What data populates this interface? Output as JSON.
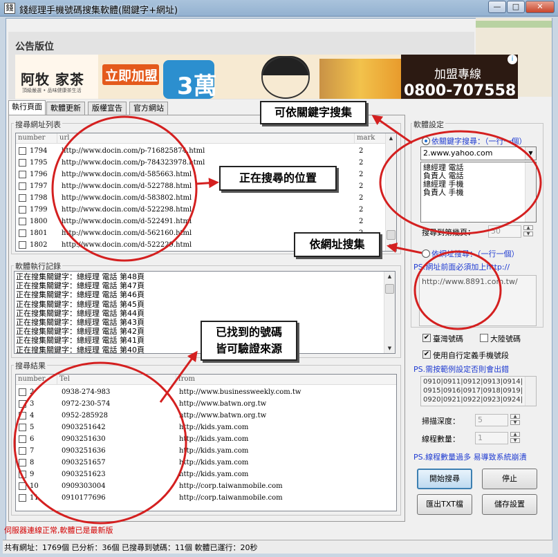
{
  "window": {
    "title": "錢經理手機號碼搜集軟體(關鍵字+網址)",
    "minimize": "—",
    "maximize": "□",
    "close": "✕"
  },
  "announcement": {
    "title": "公告版位",
    "ad": {
      "brand": "阿牧 家茶",
      "brand_sub": "頂級嚴選 • 品味健康茶生活",
      "join": "立即加盟",
      "big_number": "3萬",
      "hotline_label": "加盟專線",
      "phone": "0800-707558"
    }
  },
  "tabs": [
    {
      "label": "執行頁面",
      "active": true
    },
    {
      "label": "軟體更新",
      "active": false
    },
    {
      "label": "版權宣告",
      "active": false
    },
    {
      "label": "官方網站",
      "active": false
    }
  ],
  "url_list": {
    "title": "搜尋網址列表",
    "columns": [
      "number",
      "url",
      "mark"
    ],
    "rows": [
      {
        "number": "1794",
        "url": "http://www.docin.com/p-716825874.html",
        "mark": "2"
      },
      {
        "number": "1795",
        "url": "http://www.docin.com/p-784323978.html",
        "mark": "2"
      },
      {
        "number": "1796",
        "url": "http://www.docin.com/d-585663.html",
        "mark": "2"
      },
      {
        "number": "1797",
        "url": "http://www.docin.com/d-522788.html",
        "mark": "2"
      },
      {
        "number": "1798",
        "url": "http://www.docin.com/d-583802.html",
        "mark": "2"
      },
      {
        "number": "1799",
        "url": "http://www.docin.com/d-522298.html",
        "mark": "2"
      },
      {
        "number": "1800",
        "url": "http://www.docin.com/d-522491.html",
        "mark": "2"
      },
      {
        "number": "1801",
        "url": "http://www.docin.com/d-562160.html",
        "mark": "2"
      },
      {
        "number": "1802",
        "url": "http://www.docin.com/d-522229.html",
        "mark": "2"
      }
    ]
  },
  "log": {
    "title": "軟體執行記錄",
    "lines": [
      "正在搜集關鍵字：總經理 電話  第48頁",
      "正在搜集關鍵字：總經理 電話  第47頁",
      "正在搜集關鍵字：總經理 電話  第46頁",
      "正在搜集關鍵字：總經理 電話  第45頁",
      "正在搜集關鍵字：總經理 電話  第44頁",
      "正在搜集關鍵字：總經理 電話  第43頁",
      "正在搜集關鍵字：總經理 電話  第42頁",
      "正在搜集關鍵字：總經理 電話  第41頁",
      "正在搜集關鍵字：總經理 電話  第40頁"
    ]
  },
  "results": {
    "title": "搜尋結果",
    "columns": [
      "number",
      "Tel",
      "from"
    ],
    "rows": [
      {
        "number": "2",
        "tel": "0938-274-983",
        "from": "http://www.businessweekly.com.tw"
      },
      {
        "number": "3",
        "tel": "0972-230-574",
        "from": "http://www.batwn.org.tw"
      },
      {
        "number": "4",
        "tel": "0952-285928",
        "from": "http://www.batwn.org.tw"
      },
      {
        "number": "5",
        "tel": "0903251642",
        "from": "http://kids.yam.com"
      },
      {
        "number": "6",
        "tel": "0903251630",
        "from": "http://kids.yam.com"
      },
      {
        "number": "7",
        "tel": "0903251636",
        "from": "http://kids.yam.com"
      },
      {
        "number": "8",
        "tel": "0903251657",
        "from": "http://kids.yam.com"
      },
      {
        "number": "9",
        "tel": "0903251623",
        "from": "http://kids.yam.com"
      },
      {
        "number": "10",
        "tel": "0909303004",
        "from": "http://corp.taiwanmobile.com"
      },
      {
        "number": "11",
        "tel": "0910177696",
        "from": "http://corp.taiwanmobile.com"
      }
    ]
  },
  "settings": {
    "title": "軟體設定",
    "keyword_radio": "依關鍵字搜尋：（一行一個）",
    "search_engine": "2.www.yahoo.com",
    "keywords": [
      "總經理 電話",
      "負責人 電話",
      "總經理 手機",
      "負責人 手機"
    ],
    "pages_label": "搜尋到第幾頁：",
    "pages_value": "50",
    "url_radio": "依網址搜尋：（一行一個）",
    "url_note": "PS:網址前面必須加上http://",
    "url_box_value": "http://www.8891.com.tw/",
    "taiwan_label": "臺灣號碼",
    "china_label": "大陸號碼",
    "custom_label": "使用自行定義手機號段",
    "custom_note": "PS.需按範例設定否則會出錯",
    "segments": [
      "0910|0911|0912|0913|0914|",
      "0915|0916|0917|0918|0919|",
      "0920|0921|0922|0923|0924|"
    ],
    "depth_label": "掃描深度：",
    "depth_value": "5",
    "threads_label": "線程數量：",
    "threads_value": "1",
    "threads_note": "PS.線程數量過多 易導致系統崩潰",
    "start_button": "開始搜尋",
    "stop_button": "停止",
    "export_button": "匯出TXT檔",
    "save_button": "儲存設置"
  },
  "status": {
    "message": "伺服器連線正常,軟體已是最新版",
    "bar": "共有網址：1769個   已分析：36個   已搜尋到號碼：11個   軟體已運行：20秒"
  },
  "callouts": {
    "keyword": "可依關鍵字搜集",
    "position": "正在搜尋的位置",
    "url": "依網址搜集",
    "found_line1": "已找到的號碼",
    "found_line2": "皆可驗證來源"
  },
  "colors": {
    "callout_circle": "#d42020",
    "note_blue": "#1f3bd1",
    "status_red": "#d40000"
  }
}
